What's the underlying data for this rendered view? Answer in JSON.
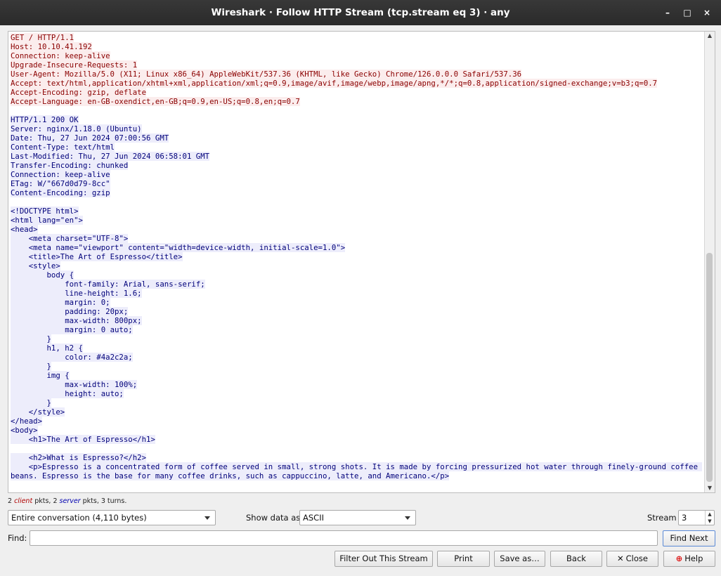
{
  "window": {
    "title": "Wireshark · Follow HTTP Stream (tcp.stream eq 3) · any",
    "minimize": "–",
    "maximize": "□",
    "close": "×"
  },
  "stream": {
    "chunks": [
      {
        "side": "client",
        "text": "GET / HTTP/1.1\nHost: 10.10.41.192\nConnection: keep-alive\nUpgrade-Insecure-Requests: 1\nUser-Agent: Mozilla/5.0 (X11; Linux x86_64) AppleWebKit/537.36 (KHTML, like Gecko) Chrome/126.0.0.0 Safari/537.36\nAccept: text/html,application/xhtml+xml,application/xml;q=0.9,image/avif,image/webp,image/apng,*/*;q=0.8,application/signed-exchange;v=b3;q=0.7\nAccept-Encoding: gzip, deflate\nAccept-Language: en-GB-oxendict,en-GB;q=0.9,en-US;q=0.8,en;q=0.7\n\n"
      },
      {
        "side": "server",
        "text": "HTTP/1.1 200 OK\nServer: nginx/1.18.0 (Ubuntu)\nDate: Thu, 27 Jun 2024 07:00:56 GMT\nContent-Type: text/html\nLast-Modified: Thu, 27 Jun 2024 06:58:01 GMT\nTransfer-Encoding: chunked\nConnection: keep-alive\nETag: W/\"667d0d79-8cc\"\nContent-Encoding: gzip\n\n<!DOCTYPE html>\n<html lang=\"en\">\n<head>\n    <meta charset=\"UTF-8\">\n    <meta name=\"viewport\" content=\"width=device-width, initial-scale=1.0\">\n    <title>The Art of Espresso</title>\n    <style>\n        body {\n            font-family: Arial, sans-serif;\n            line-height: 1.6;\n            margin: 0;\n            padding: 20px;\n            max-width: 800px;\n            margin: 0 auto;\n        }\n        h1, h2 {\n            color: #4a2c2a;\n        }\n        img {\n            max-width: 100%;\n            height: auto;\n        }\n    </style>\n</head>\n<body>\n    <h1>The Art of Espresso</h1>\n\n    <h2>What is Espresso?</h2>\n    <p>Espresso is a concentrated form of coffee served in small, strong shots. It is made by forcing pressurized hot water through finely-ground coffee beans. Espresso is the base for many coffee drinks, such as cappuccino, latte, and Americano.</p>"
      }
    ]
  },
  "stats": {
    "client_count": "2",
    "client_word": "client",
    "mid": " pkts, ",
    "server_count": "2",
    "server_word": "server",
    "tail": " pkts, 3 turns."
  },
  "controls": {
    "conversation": "Entire conversation (4,110 bytes)",
    "show_data_label": "Show data as",
    "show_data_value": "ASCII",
    "stream_label": "Stream",
    "stream_value": "3",
    "find_label": "Find:",
    "find_value": "",
    "find_next": "Find Next"
  },
  "buttons": {
    "filter_out": "Filter Out This Stream",
    "print": "Print",
    "save_as": "Save as…",
    "back": "Back",
    "close": "Close",
    "help": "Help"
  },
  "colors": {
    "client_text": "#8b0000",
    "client_bg": "#fbeded",
    "server_text": "#00007a",
    "server_bg": "#ededfb"
  }
}
